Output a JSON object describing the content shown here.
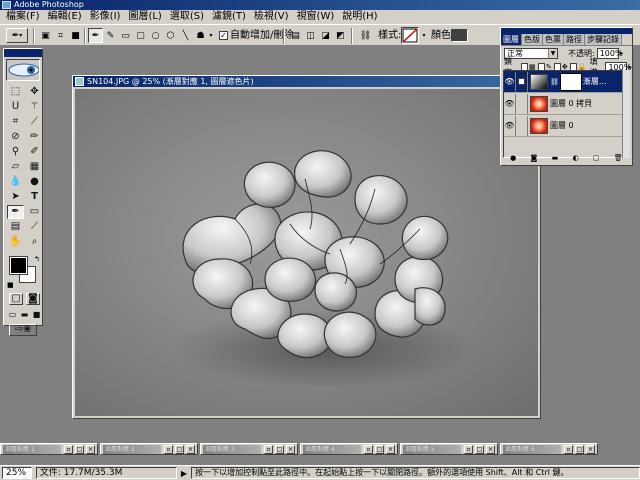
{
  "app": {
    "title": "Adobe Photoshop"
  },
  "menu": [
    "檔案(F)",
    "編輯(E)",
    "影像(I)",
    "圖層(L)",
    "選取(S)",
    "濾鏡(T)",
    "檢視(V)",
    "視窗(W)",
    "說明(H)"
  ],
  "options": {
    "auto_add_delete_label": "自動增加/刪除",
    "auto_add_delete_checked": "✓",
    "style_label": "樣式:",
    "color_label": "顏色:",
    "color_value": "#404040"
  },
  "document": {
    "title": "SN104.JPG @ 25% (漸層對應 1, 圖層遮色片)"
  },
  "layers_palette": {
    "tabs": [
      "圖層",
      "色版",
      "色票",
      "路徑",
      "步驟記錄"
    ],
    "blend_mode": "正常",
    "opacity_label": "不透明:",
    "opacity_value": "100%",
    "lock_label": "鎖定:",
    "fill_label": "填滿:",
    "fill_value": "100%",
    "layers": [
      {
        "name": "漸層...",
        "selected": true
      },
      {
        "name": "圖層 0 拷貝",
        "selected": false
      },
      {
        "name": "圖層 0",
        "selected": false
      }
    ]
  },
  "minimized_windows": [
    "漸層對應 1",
    "漸層對應 2",
    "漸層對應 3",
    "漸層對應 4",
    "漸層對應 5",
    "漸層對應 6"
  ],
  "status": {
    "zoom": "25%",
    "doc_size": "文件: 17.7M/35.3M",
    "hint": "按一下以增加控制點至此路徑中。在起始點上按一下以關閉路徑。額外的選項使用 Shift、Alt 和 Ctrl 鍵。"
  },
  "colors": {
    "title_blue": "#08246b",
    "panel_gray": "#d4d0c8",
    "workspace": "#808080"
  }
}
